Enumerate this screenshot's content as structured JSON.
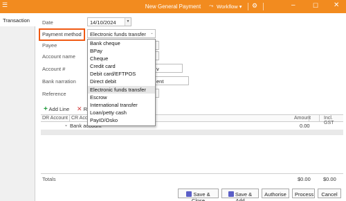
{
  "window": {
    "title": "New General Payment",
    "workflow_label": "Workflow"
  },
  "left_tabs": [
    "Transaction"
  ],
  "form": {
    "date_label": "Date",
    "date_value": "14/10/2024",
    "payment_method_label": "Payment method",
    "payment_method_value": "Electronic funds transfer",
    "payee_label": "Payee",
    "account_name_label": "Account name",
    "account_number_label": "Account #",
    "bank_narration_label": "Bank narration",
    "reference_label": "Reference",
    "partial_account_value": "v",
    "partial_narration_value": "ent"
  },
  "dropdown": {
    "options": [
      "Bank cheque",
      "BPay",
      "Cheque",
      "Credit card",
      "Debit card/EFTPOS",
      "Direct debit",
      "Electronic funds transfer",
      "Escrow",
      "International transfer",
      "Loan/petty cash",
      "PayID/Osko"
    ],
    "selected": "Electronic funds transfer"
  },
  "toolbar": {
    "add_line_label": "Add Line",
    "remove_partial_label": "R"
  },
  "grid": {
    "headers": [
      "DR Account",
      "CR Acco",
      "Amount",
      "Incl. GST"
    ],
    "row_label": "Bank account",
    "row_amount": "0.00"
  },
  "totals": {
    "label": "Totals",
    "amount": "$0.00",
    "gst": "$0.00"
  },
  "buttons": {
    "save_close": "Save & Close",
    "save_add": "Save & Add",
    "authorise": "Authorise",
    "process": "Process",
    "cancel": "Cancel"
  },
  "colors": {
    "titlebar": "#f28b1f",
    "highlight": "#f05a13",
    "add_icon": "#1e9a3a",
    "remove_icon": "#d23b3b"
  }
}
